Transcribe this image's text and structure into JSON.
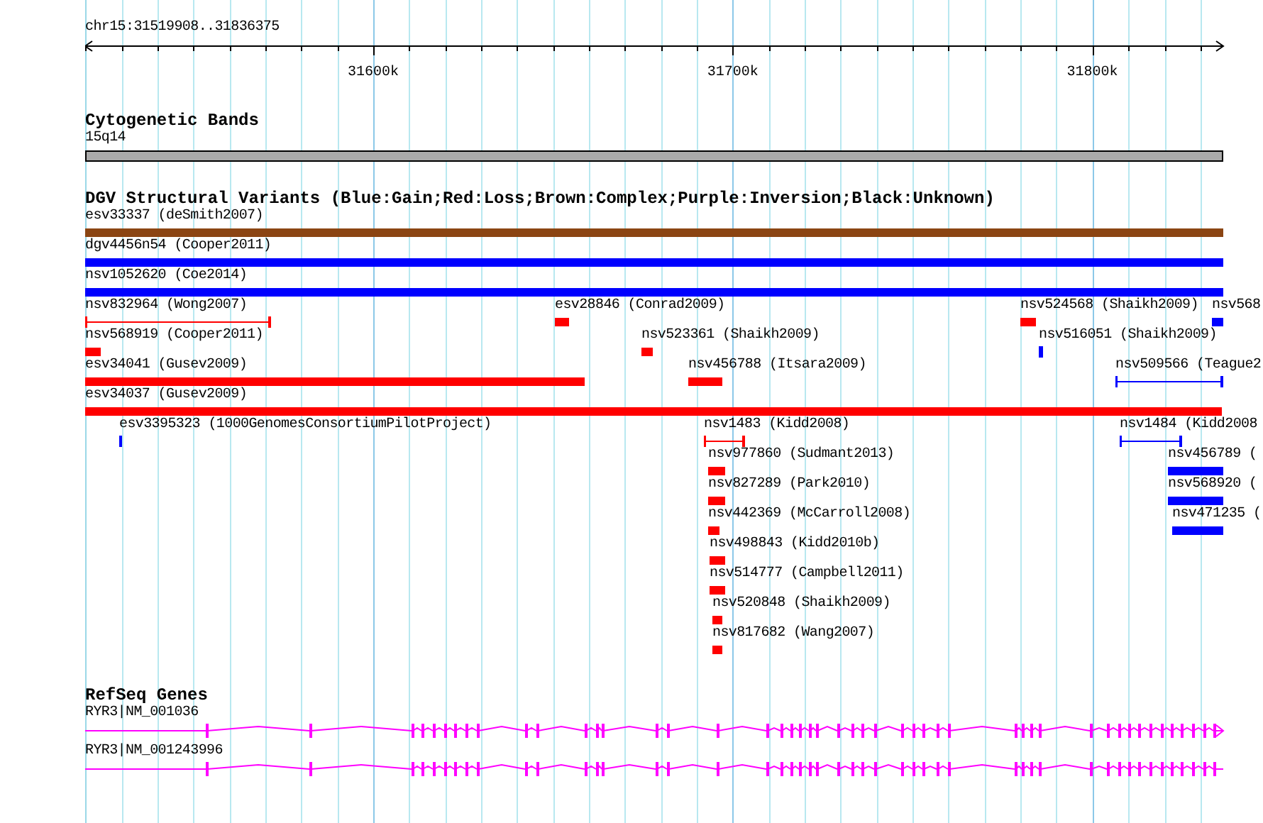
{
  "location": "chr15:31519908..31836375",
  "ruler": {
    "ticks": [
      "31600k",
      "31700k",
      "31800k"
    ]
  },
  "cytobands": {
    "title": "Cytogenetic Bands",
    "band": "15q14"
  },
  "variants": {
    "title": "DGV Structural Variants (Blue:Gain;Red:Loss;Brown:Complex;Purple:Inversion;Black:Unknown)",
    "rows": [
      {
        "features": [
          {
            "label": "esv33337 (deSmith2007)",
            "kind": "block",
            "color": "#8b4513"
          }
        ]
      },
      {
        "features": [
          {
            "label": "dgv4456n54 (Cooper2011)",
            "kind": "block",
            "color": "#0000ff"
          }
        ]
      },
      {
        "features": [
          {
            "label": "nsv1052620 (Coe2014)",
            "kind": "block",
            "color": "#0000ff"
          }
        ]
      },
      {
        "features": [
          {
            "label": "nsv832964 (Wong2007)",
            "kind": "span",
            "color": "#ff0000"
          },
          {
            "label": "esv28846 (Conrad2009)",
            "kind": "block",
            "color": "#ff0000"
          },
          {
            "label": "nsv524568 (Shaikh2009)",
            "kind": "block",
            "color": "#ff0000"
          },
          {
            "label": "nsv568",
            "kind": "block",
            "color": "#0000ff"
          }
        ]
      },
      {
        "features": [
          {
            "label": "nsv568919 (Cooper2011)",
            "kind": "block",
            "color": "#ff0000"
          },
          {
            "label": "nsv523361 (Shaikh2009)",
            "kind": "block",
            "color": "#ff0000"
          },
          {
            "label": "nsv516051 (Shaikh2009)",
            "kind": "block",
            "color": "#0000ff"
          }
        ]
      },
      {
        "features": [
          {
            "label": "esv34041 (Gusev2009)",
            "kind": "block",
            "color": "#ff0000"
          },
          {
            "label": "nsv456788 (Itsara2009)",
            "kind": "block",
            "color": "#ff0000"
          },
          {
            "label": "nsv509566 (Teague2",
            "kind": "span",
            "color": "#0000ff"
          }
        ]
      },
      {
        "features": [
          {
            "label": "esv34037 (Gusev2009)",
            "kind": "block",
            "color": "#ff0000"
          }
        ]
      },
      {
        "features": [
          {
            "label": "esv3395323 (1000GenomesConsortiumPilotProject)",
            "kind": "block",
            "color": "#0000ff"
          },
          {
            "label": "nsv1483 (Kidd2008)",
            "kind": "span",
            "color": "#ff0000"
          },
          {
            "label": "nsv1484 (Kidd2008",
            "kind": "span",
            "color": "#0000ff"
          }
        ]
      },
      {
        "features": [
          {
            "label": "nsv977860 (Sudmant2013)",
            "kind": "block",
            "color": "#ff0000"
          },
          {
            "label": "nsv456789 (",
            "kind": "block",
            "color": "#0000ff"
          }
        ]
      },
      {
        "features": [
          {
            "label": "nsv827289 (Park2010)",
            "kind": "block",
            "color": "#ff0000"
          },
          {
            "label": "nsv568920 (",
            "kind": "block",
            "color": "#0000ff"
          }
        ]
      },
      {
        "features": [
          {
            "label": "nsv442369 (McCarroll2008)",
            "kind": "block",
            "color": "#ff0000"
          },
          {
            "label": "nsv471235 (",
            "kind": "block",
            "color": "#0000ff"
          }
        ]
      },
      {
        "features": [
          {
            "label": "nsv498843 (Kidd2010b)",
            "kind": "block",
            "color": "#ff0000"
          }
        ]
      },
      {
        "features": [
          {
            "label": "nsv514777 (Campbell2011)",
            "kind": "block",
            "color": "#ff0000"
          }
        ]
      },
      {
        "features": [
          {
            "label": "nsv520848 (Shaikh2009)",
            "kind": "block",
            "color": "#ff0000"
          }
        ]
      },
      {
        "features": [
          {
            "label": "nsv817682 (Wang2007)",
            "kind": "block",
            "color": "#ff0000"
          }
        ]
      }
    ]
  },
  "genes": {
    "title": "RefSeq Genes",
    "transcripts": [
      {
        "label": "RYR3|NM_001036"
      },
      {
        "label": "RYR3|NM_001243996"
      }
    ]
  }
}
